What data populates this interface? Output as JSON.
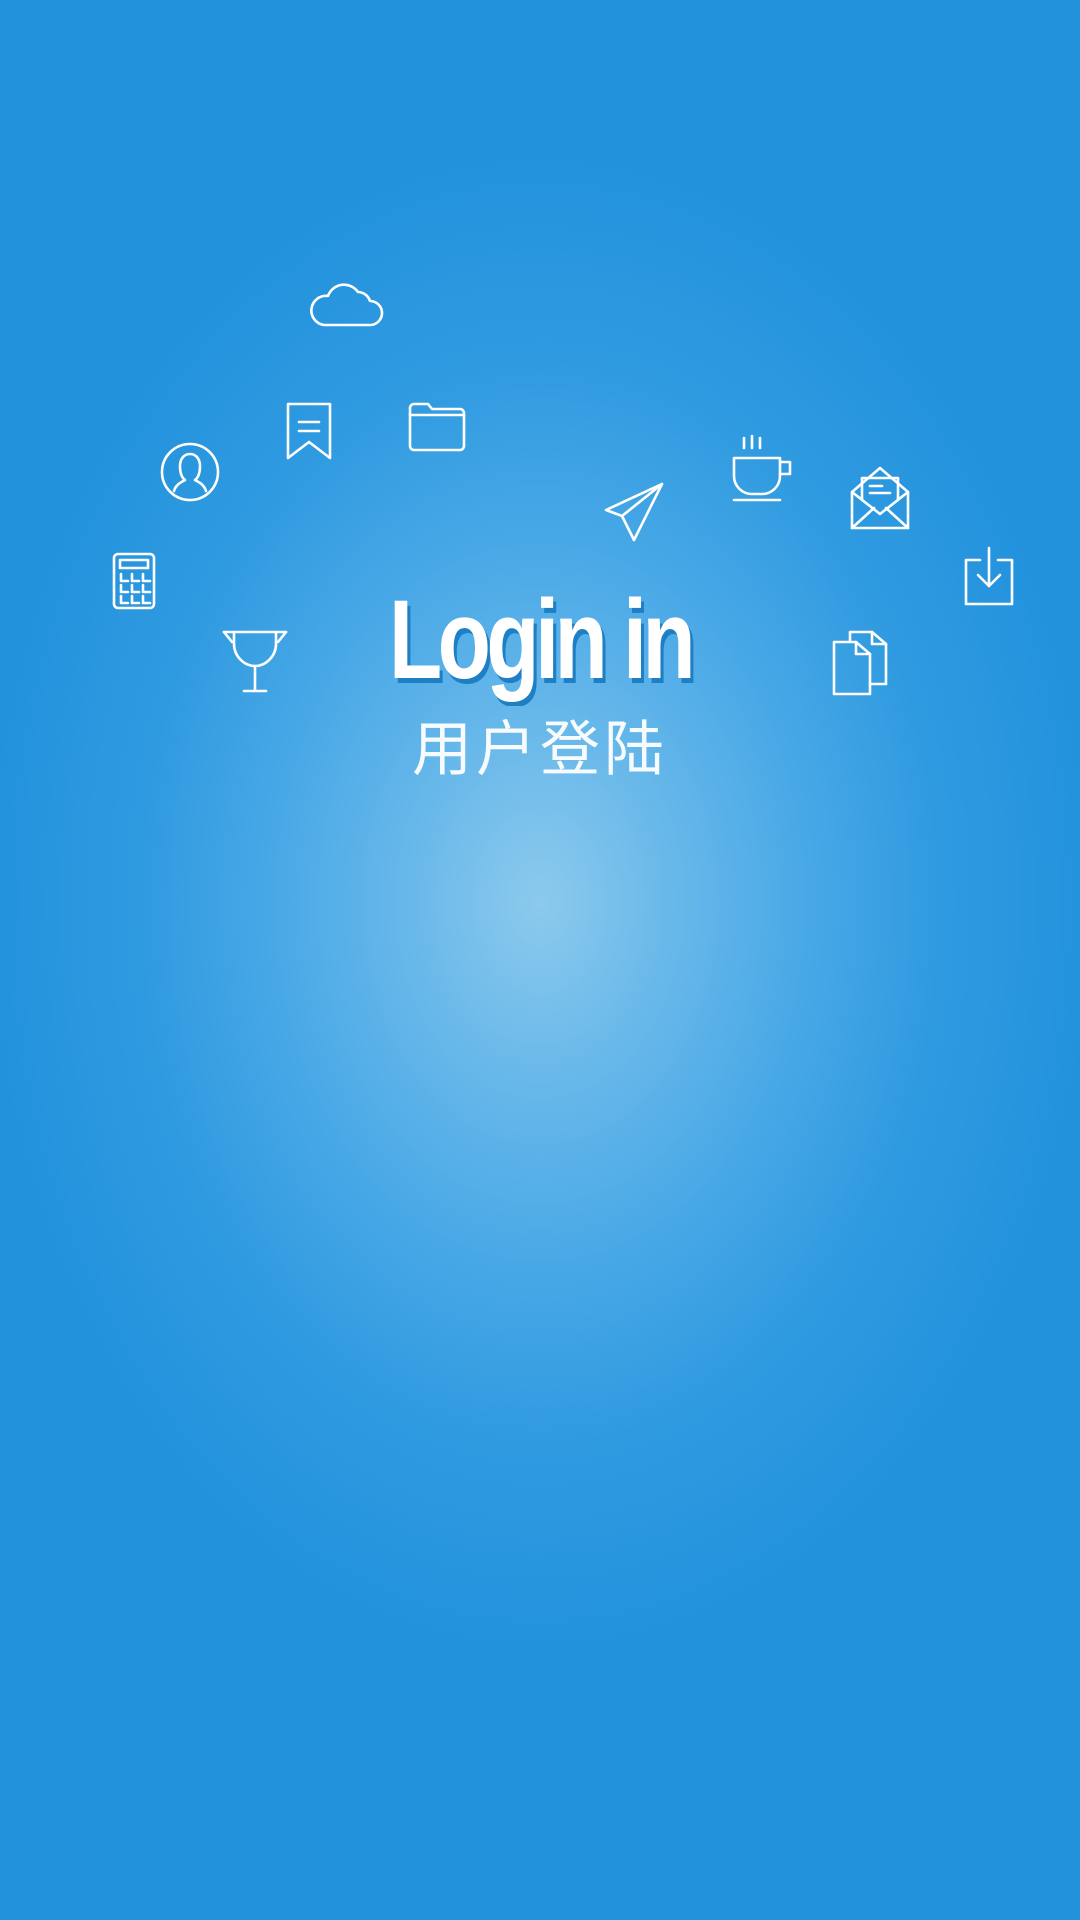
{
  "login": {
    "title": "Login in",
    "subtitle": "用户登陆"
  },
  "theme": {
    "background_outer": "#2292dd",
    "background_center": "#8ccaed",
    "foreground": "#ffffff"
  },
  "icons": [
    "cloud-icon",
    "bookmark-icon",
    "folder-icon",
    "user-icon",
    "calculator-icon",
    "trophy-icon",
    "paper-plane-icon",
    "coffee-cup-icon",
    "envelope-icon",
    "download-icon",
    "documents-icon"
  ]
}
